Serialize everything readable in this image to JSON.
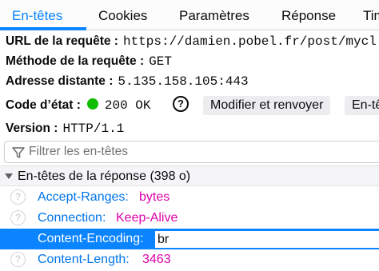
{
  "tabs": [
    {
      "label": "En-têtes",
      "active": true
    },
    {
      "label": "Cookies",
      "active": false
    },
    {
      "label": "Paramètres",
      "active": false
    },
    {
      "label": "Réponse",
      "active": false
    },
    {
      "label": "Tim",
      "active": false
    }
  ],
  "summary": {
    "url_label": "URL de la requête :",
    "url_value": "https://damien.pobel.fr/post/mycl",
    "method_label": "Méthode de la requête :",
    "method_value": "GET",
    "address_label": "Adresse distante :",
    "address_value": "5.135.158.105:443",
    "status_label": "Code d’état :",
    "status_value": "200 OK",
    "status_color": "#12bc00",
    "help_glyph": "?",
    "edit_resend_label": "Modifier et renvoyer",
    "raw_headers_label": "En-tê",
    "version_label": "Version :",
    "version_value": "HTTP/1.1"
  },
  "filter": {
    "placeholder": "Filtrer les en-têtes",
    "icon": "filter-icon"
  },
  "response_headers": {
    "title": "En-têtes de la réponse (398 o)",
    "rows": [
      {
        "name": "Accept-Ranges:",
        "value": "bytes",
        "selected": false
      },
      {
        "name": "Connection:",
        "value": "Keep-Alive",
        "selected": false
      },
      {
        "name": "Content-Encoding:",
        "value": "br",
        "selected": true
      },
      {
        "name": "Content-Length:",
        "value": "3463",
        "selected": false
      }
    ],
    "help_glyph": "?"
  },
  "colors": {
    "accent": "#0a84ff",
    "header_name": "#0074e8",
    "header_value": "#dd00a9"
  }
}
